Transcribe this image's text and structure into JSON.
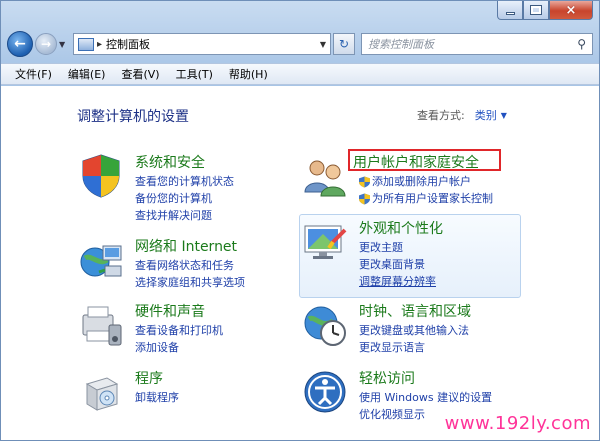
{
  "window": {
    "caption_min": "minimize-glyph",
    "caption_max": "maximize-glyph",
    "caption_close": "×"
  },
  "nav": {
    "back_glyph": "←",
    "forward_glyph": "→",
    "history_glyph": "▼",
    "address_text": "控制面板",
    "address_sep": "▸",
    "address_drop": "▼",
    "refresh_glyph": "↻",
    "search_placeholder": "搜索控制面板",
    "search_glyph": "⚲"
  },
  "menu": [
    {
      "label": "文件(F)"
    },
    {
      "label": "编辑(E)"
    },
    {
      "label": "查看(V)"
    },
    {
      "label": "工具(T)"
    },
    {
      "label": "帮助(H)"
    }
  ],
  "content": {
    "title": "调整计算机的设置",
    "view_label": "查看方式:",
    "view_value": "类别",
    "view_arrow": "▼"
  },
  "categories": {
    "system": {
      "title": "系统和安全",
      "links": [
        "查看您的计算机状态",
        "备份您的计算机",
        "查找并解决问题"
      ]
    },
    "network": {
      "title": "网络和 Internet",
      "links": [
        "查看网络状态和任务",
        "选择家庭组和共享选项"
      ]
    },
    "hardware": {
      "title": "硬件和声音",
      "links": [
        "查看设备和打印机",
        "添加设备"
      ]
    },
    "programs": {
      "title": "程序",
      "links": [
        "卸载程序"
      ]
    },
    "users": {
      "title": "用户帐户和家庭安全",
      "links": [
        "添加或删除用户帐户",
        "为所有用户设置家长控制"
      ]
    },
    "appearance": {
      "title": "外观和个性化",
      "links": [
        "更改主题",
        "更改桌面背景",
        "调整屏幕分辨率"
      ]
    },
    "clock": {
      "title": "时钟、语言和区域",
      "links": [
        "更改键盘或其他输入法",
        "更改显示语言"
      ]
    },
    "ease": {
      "title": "轻松访问",
      "links": [
        "使用 Windows 建议的设置",
        "优化视频显示"
      ]
    }
  },
  "watermark": "www.192ly.com",
  "colors": {
    "category_title": "#1b7a1b",
    "link": "#1e3fa8",
    "highlight": "#e0262a",
    "watermark": "#ff3399"
  }
}
